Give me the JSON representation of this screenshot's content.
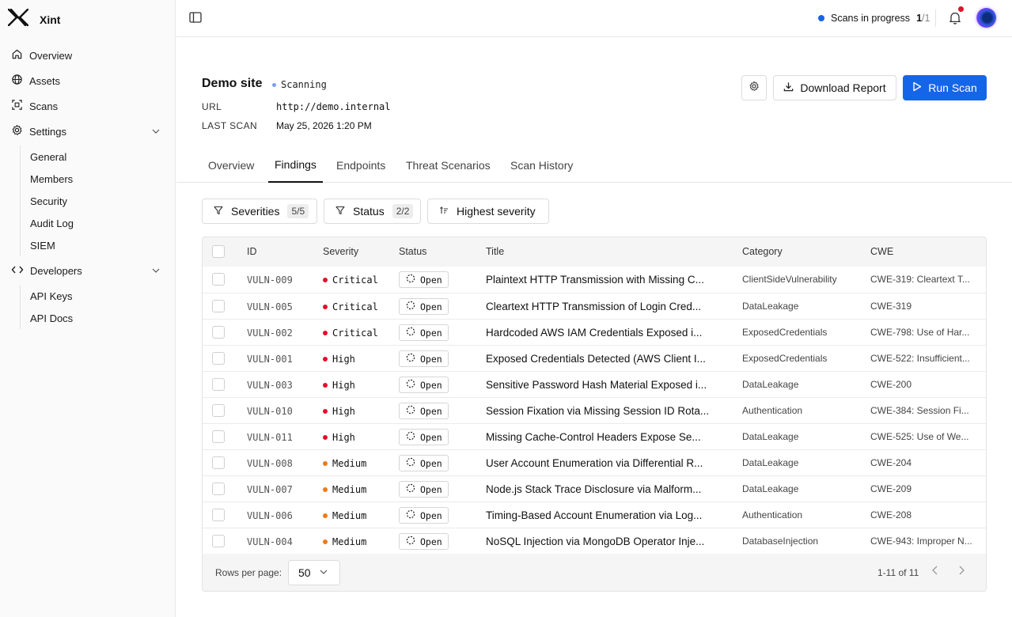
{
  "app": {
    "name": "Xint"
  },
  "sidebar": {
    "items": [
      {
        "label": "Overview"
      },
      {
        "label": "Assets"
      },
      {
        "label": "Scans"
      },
      {
        "label": "Settings"
      },
      {
        "label": "Developers"
      }
    ],
    "settings_sub": [
      "General",
      "Members",
      "Security",
      "Audit Log",
      "SIEM"
    ],
    "developers_sub": [
      "API Keys",
      "API Docs"
    ]
  },
  "header": {
    "scans_label": "Scans in progress",
    "scans_current": "1",
    "scans_total": "/1"
  },
  "site": {
    "name": "Demo site",
    "status": "Scanning",
    "url_label": "URL",
    "url": "http://demo.internal",
    "last_scan_label": "LAST SCAN",
    "last_scan": "May 25, 2026 1:20 PM",
    "download_label": "Download Report",
    "run_label": "Run Scan"
  },
  "tabs": [
    "Overview",
    "Findings",
    "Endpoints",
    "Threat Scenarios",
    "Scan History"
  ],
  "filters": {
    "severities_label": "Severities",
    "severities_count": "5/5",
    "status_label": "Status",
    "status_count": "2/2",
    "sort_label": "Highest severity"
  },
  "table": {
    "columns": [
      "ID",
      "Severity",
      "Status",
      "Title",
      "Category",
      "CWE"
    ],
    "rows": [
      {
        "id": "VULN-009",
        "severity": "Critical",
        "status": "Open",
        "title": "Plaintext HTTP Transmission with Missing C...",
        "category": "ClientSideVulnerability",
        "cwe": "CWE-319: Cleartext T..."
      },
      {
        "id": "VULN-005",
        "severity": "Critical",
        "status": "Open",
        "title": "Cleartext HTTP Transmission of Login Cred...",
        "category": "DataLeakage",
        "cwe": "CWE-319"
      },
      {
        "id": "VULN-002",
        "severity": "Critical",
        "status": "Open",
        "title": "Hardcoded AWS IAM Credentials Exposed i...",
        "category": "ExposedCredentials",
        "cwe": "CWE-798: Use of Har..."
      },
      {
        "id": "VULN-001",
        "severity": "High",
        "status": "Open",
        "title": "Exposed Credentials Detected (AWS Client I...",
        "category": "ExposedCredentials",
        "cwe": "CWE-522: Insufficient..."
      },
      {
        "id": "VULN-003",
        "severity": "High",
        "status": "Open",
        "title": "Sensitive Password Hash Material Exposed i...",
        "category": "DataLeakage",
        "cwe": "CWE-200"
      },
      {
        "id": "VULN-010",
        "severity": "High",
        "status": "Open",
        "title": "Session Fixation via Missing Session ID Rota...",
        "category": "Authentication",
        "cwe": "CWE-384: Session Fi..."
      },
      {
        "id": "VULN-011",
        "severity": "High",
        "status": "Open",
        "title": "Missing Cache-Control Headers Expose Se...",
        "category": "DataLeakage",
        "cwe": "CWE-525: Use of We..."
      },
      {
        "id": "VULN-008",
        "severity": "Medium",
        "status": "Open",
        "title": "User Account Enumeration via Differential R...",
        "category": "DataLeakage",
        "cwe": "CWE-204"
      },
      {
        "id": "VULN-007",
        "severity": "Medium",
        "status": "Open",
        "title": "Node.js Stack Trace Disclosure via Malform...",
        "category": "DataLeakage",
        "cwe": "CWE-209"
      },
      {
        "id": "VULN-006",
        "severity": "Medium",
        "status": "Open",
        "title": "Timing-Based Account Enumeration via Log...",
        "category": "Authentication",
        "cwe": "CWE-208"
      },
      {
        "id": "VULN-004",
        "severity": "Medium",
        "status": "Open",
        "title": "NoSQL Injection via MongoDB Operator Inje...",
        "category": "DatabaseInjection",
        "cwe": "CWE-943: Improper N..."
      }
    ]
  },
  "pagination": {
    "rows_per_page_label": "Rows per page:",
    "rows_per_page": "50",
    "range": "1-11 of 11"
  },
  "colors": {
    "accent": "#1565e8",
    "critical": "#e0112b",
    "high": "#e0112b",
    "medium": "#f07a16",
    "notification": "#e0112b"
  }
}
